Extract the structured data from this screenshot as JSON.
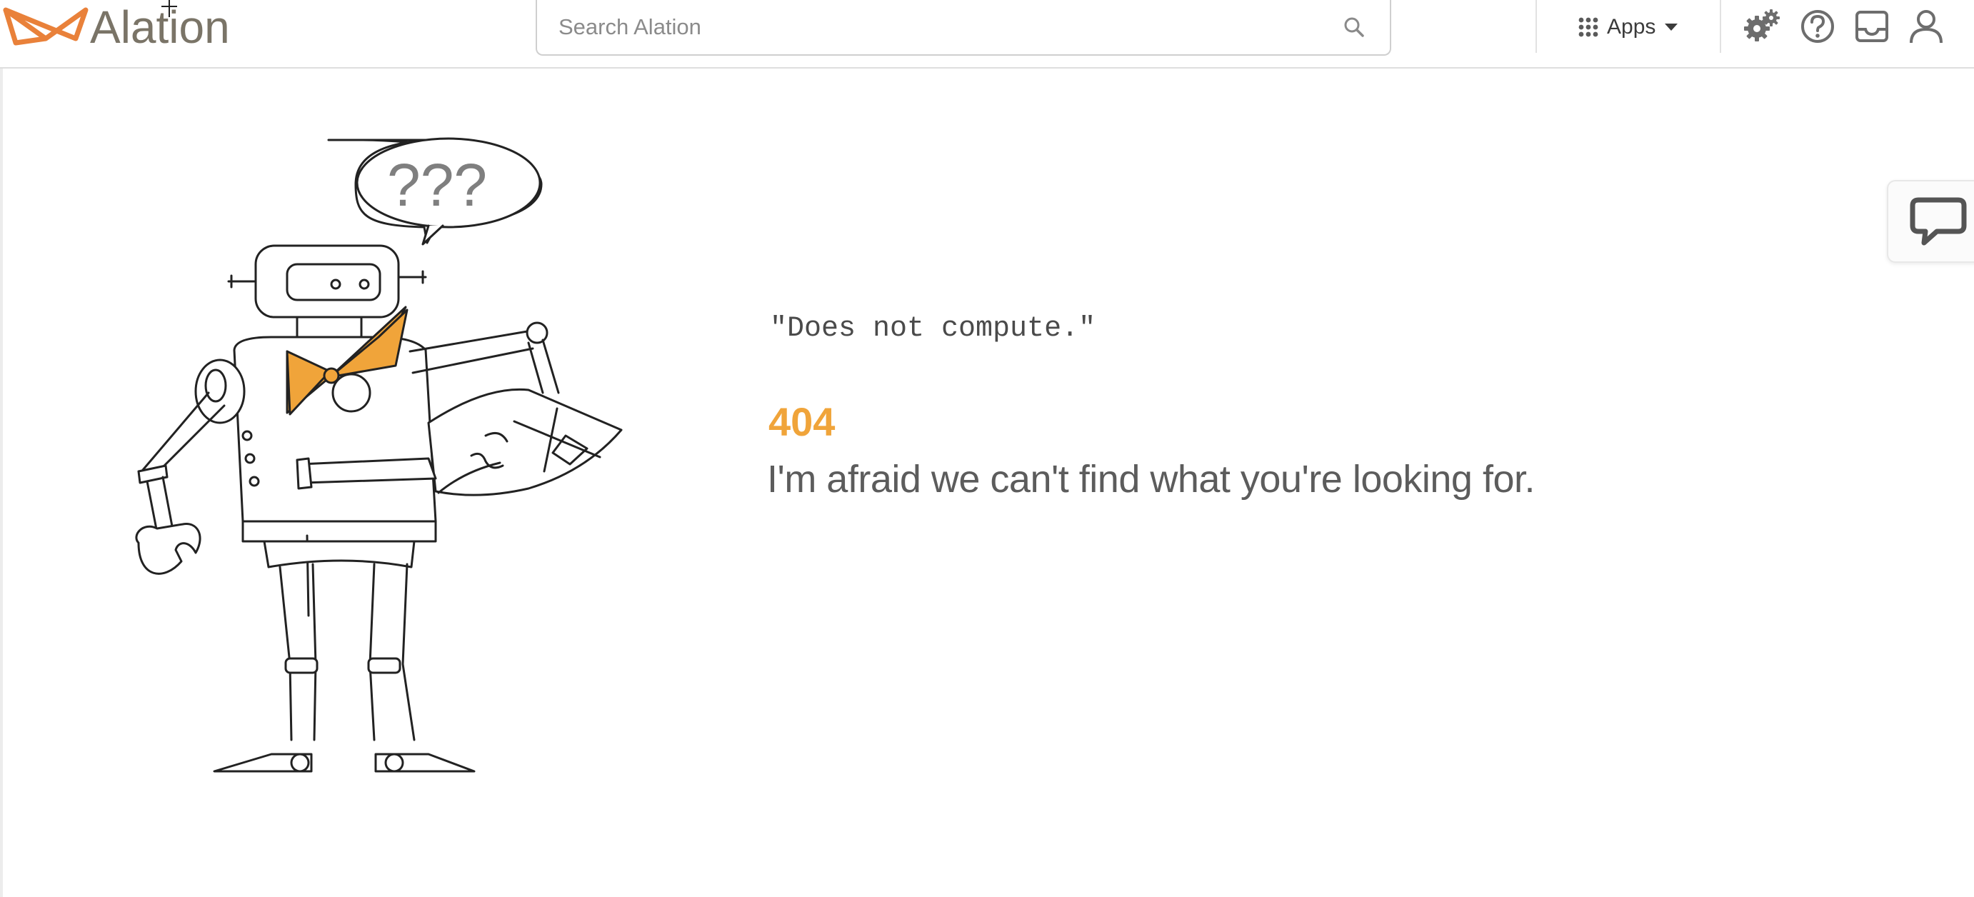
{
  "brand": {
    "name": "Alation",
    "accent": "#f0a43a",
    "logo_color": "#e9813a",
    "text_color": "#7a7467"
  },
  "header": {
    "search": {
      "placeholder": "Search Alation",
      "value": ""
    },
    "apps": {
      "label": "Apps",
      "icon": "grid-icon"
    },
    "icons": [
      "settings-gears-icon",
      "help-icon",
      "inbox-icon",
      "user-icon"
    ]
  },
  "error_page": {
    "quote": "\"Does not compute.\"",
    "code": "404",
    "message": "I'm afraid we can't find what you're looking for."
  },
  "feedback": {
    "icon": "chat-bubble-icon"
  }
}
